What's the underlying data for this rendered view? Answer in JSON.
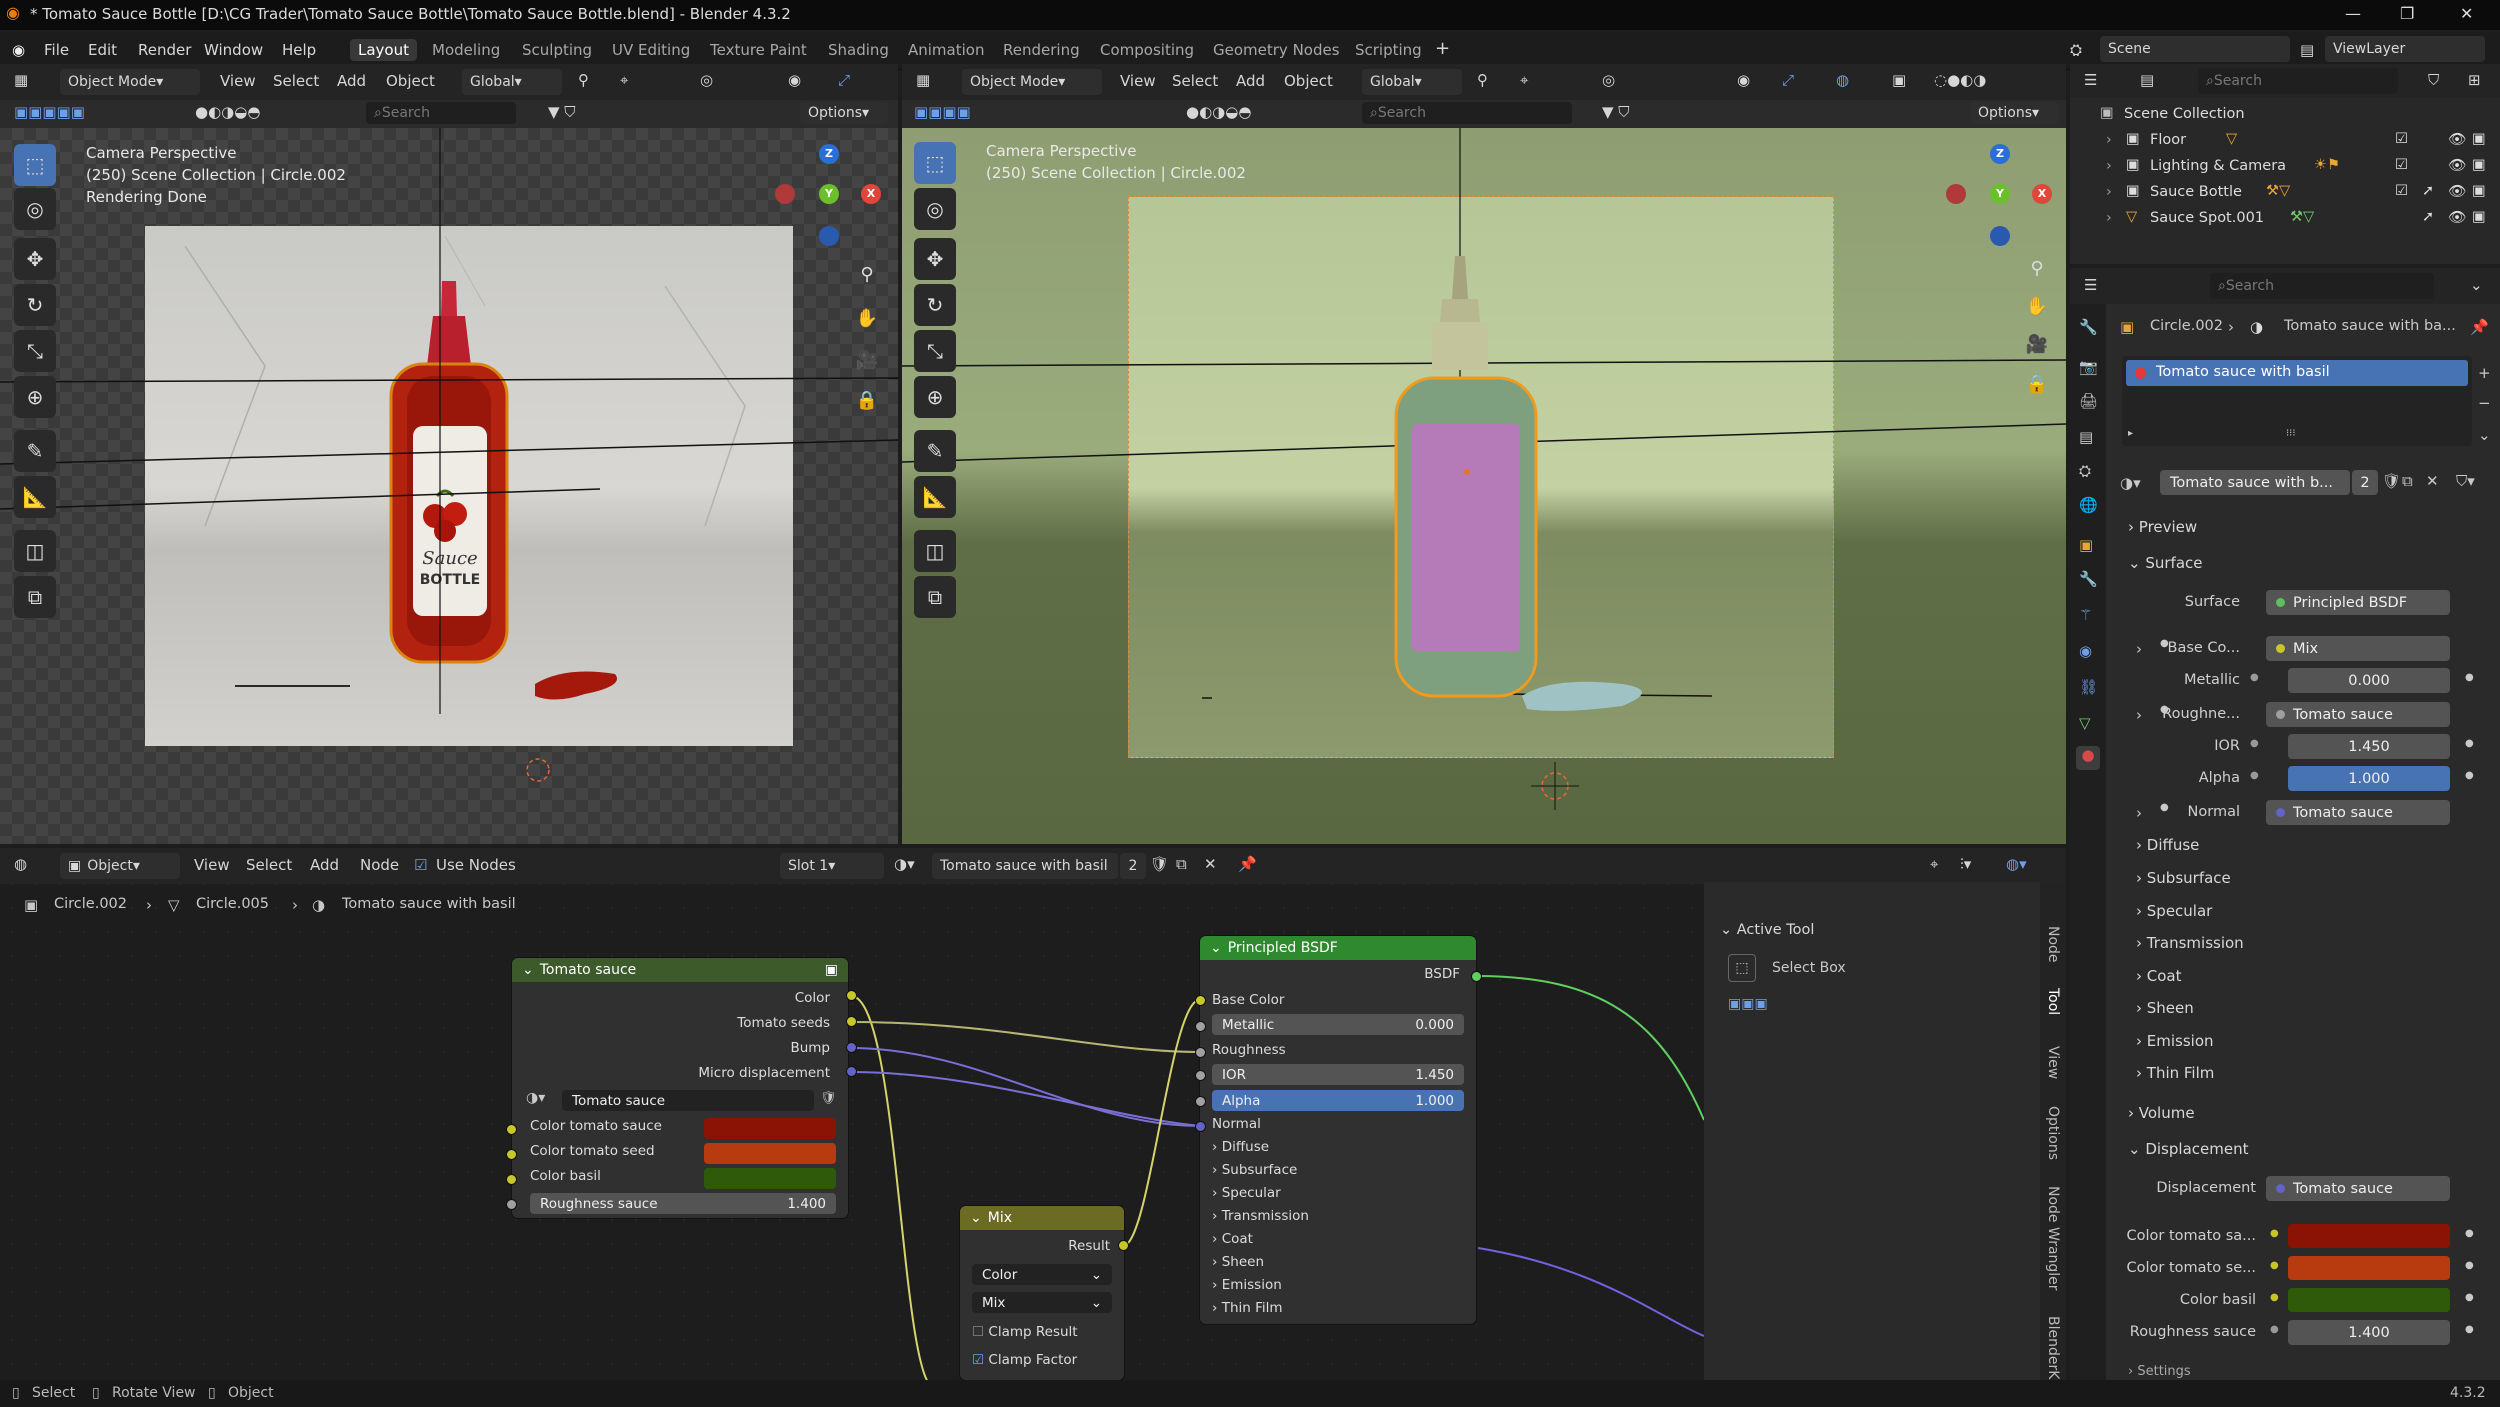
{
  "title": "* Tomato Sauce Bottle [D:\\CG Trader\\Tomato Sauce Bottle\\Tomato Sauce Bottle.blend] - Blender 4.3.2",
  "menu": [
    "File",
    "Edit",
    "Render",
    "Window",
    "Help"
  ],
  "workspaces": [
    "Layout",
    "Modeling",
    "Sculpting",
    "UV Editing",
    "Texture Paint",
    "Shading",
    "Animation",
    "Rendering",
    "Compositing",
    "Geometry Nodes",
    "Scripting"
  ],
  "scene": {
    "label": "Scene",
    "view_layer": "ViewLayer"
  },
  "vp_header": {
    "mode": "Object Mode",
    "view": "View",
    "select": "Select",
    "add": "Add",
    "object": "Object",
    "orientation": "Global",
    "options": "Options",
    "search_placeholder": "Search"
  },
  "viewport_left": {
    "line1": "Camera Perspective",
    "line2": "(250) Scene Collection | Circle.002",
    "line3": "Rendering Done",
    "label_sauce": "Sauce",
    "label_bottle": "BOTTLE"
  },
  "viewport_right": {
    "line1": "Camera Perspective",
    "line2": "(250) Scene Collection | Circle.002"
  },
  "axes": {
    "x": "X",
    "y": "Y",
    "z": "Z"
  },
  "outliner": {
    "search_placeholder": "Search",
    "root": "Scene Collection",
    "items": [
      {
        "label": "Floor"
      },
      {
        "label": "Lighting & Camera"
      },
      {
        "label": "Sauce Bottle"
      },
      {
        "label": "Sauce Spot.001"
      }
    ]
  },
  "properties": {
    "search_placeholder": "Search",
    "breadcrumb_object": "Circle.002",
    "breadcrumb_material": "Tomato sauce with ba...",
    "material_slot": "Tomato sauce with basil",
    "material_name": "Tomato sauce with b...",
    "users": "2",
    "sections": {
      "preview": "Preview",
      "surface": "Surface",
      "volume": "Volume",
      "displacement": "Displacement",
      "settings": "Settings"
    },
    "surface_rows": [
      {
        "label": "Surface",
        "value": "Principled BSDF",
        "dot": "#5fbf5f"
      },
      {
        "label": "Base Co...",
        "value": "Mix",
        "dot": "#c7c729"
      },
      {
        "label": "Metallic",
        "value": "0.000"
      },
      {
        "label": "Roughne...",
        "value": "Tomato sauce",
        "dot": "#9f9f9f"
      },
      {
        "label": "IOR",
        "value": "1.450"
      },
      {
        "label": "Alpha",
        "value": "1.000"
      },
      {
        "label": "Normal",
        "value": "Tomato sauce",
        "dot": "#6363c7"
      }
    ],
    "subpanels": [
      "Diffuse",
      "Subsurface",
      "Specular",
      "Transmission",
      "Coat",
      "Sheen",
      "Emission",
      "Thin Film"
    ],
    "displacement_rows": [
      {
        "label": "Displacement",
        "value": "Tomato sauce",
        "dot": "#6363c7"
      },
      {
        "label": "Color tomato sa...",
        "color": "#8a1306"
      },
      {
        "label": "Color tomato se...",
        "color": "#b83a0f"
      },
      {
        "label": "Color basil",
        "color": "#2f5a0a"
      },
      {
        "label": "Roughness sauce",
        "value": "1.400"
      }
    ]
  },
  "node_header": {
    "mode": "Object",
    "view": "View",
    "select": "Select",
    "add": "Add",
    "node": "Node",
    "use_nodes": "Use Nodes",
    "slot": "Slot 1",
    "material": "Tomato sauce with basil",
    "users": "2"
  },
  "node_breadcrumb": [
    "Circle.002",
    "Circle.005",
    "Tomato sauce with basil"
  ],
  "node_group": {
    "title": "Tomato sauce",
    "outputs": [
      "Color",
      "Tomato seeds",
      "Bump",
      "Micro displacement"
    ],
    "group_name": "Tomato sauce",
    "inputs": [
      {
        "label": "Color tomato sauce",
        "color": "#8a1306"
      },
      {
        "label": "Color tomato seed",
        "color": "#b83a0f"
      },
      {
        "label": "Color basil",
        "color": "#2f5a0a"
      }
    ],
    "roughness": {
      "label": "Roughness sauce",
      "value": "1.400"
    }
  },
  "node_bsdf": {
    "title": "Principled BSDF",
    "output": "BSDF",
    "base_color": "Base Color",
    "metallic": {
      "label": "Metallic",
      "value": "0.000"
    },
    "roughness": "Roughness",
    "ior": {
      "label": "IOR",
      "value": "1.450"
    },
    "alpha": {
      "label": "Alpha",
      "value": "1.000"
    },
    "normal": "Normal",
    "panels": [
      "Diffuse",
      "Subsurface",
      "Specular",
      "Transmission",
      "Coat",
      "Sheen",
      "Emission",
      "Thin Film"
    ]
  },
  "node_mix": {
    "title": "Mix",
    "output": "Result",
    "type": "Color",
    "blend": "Mix",
    "clamp_result": "Clamp Result",
    "clamp_factor": "Clamp Factor"
  },
  "active_tool": {
    "title": "Active Tool",
    "tool": "Select Box"
  },
  "side_tabs": [
    "Node",
    "Tool",
    "View",
    "Options",
    "Node Wrangler",
    "BlenderKit"
  ],
  "status": {
    "select": "Select",
    "rotate": "Rotate View",
    "object": "Object",
    "version": "4.3.2"
  }
}
